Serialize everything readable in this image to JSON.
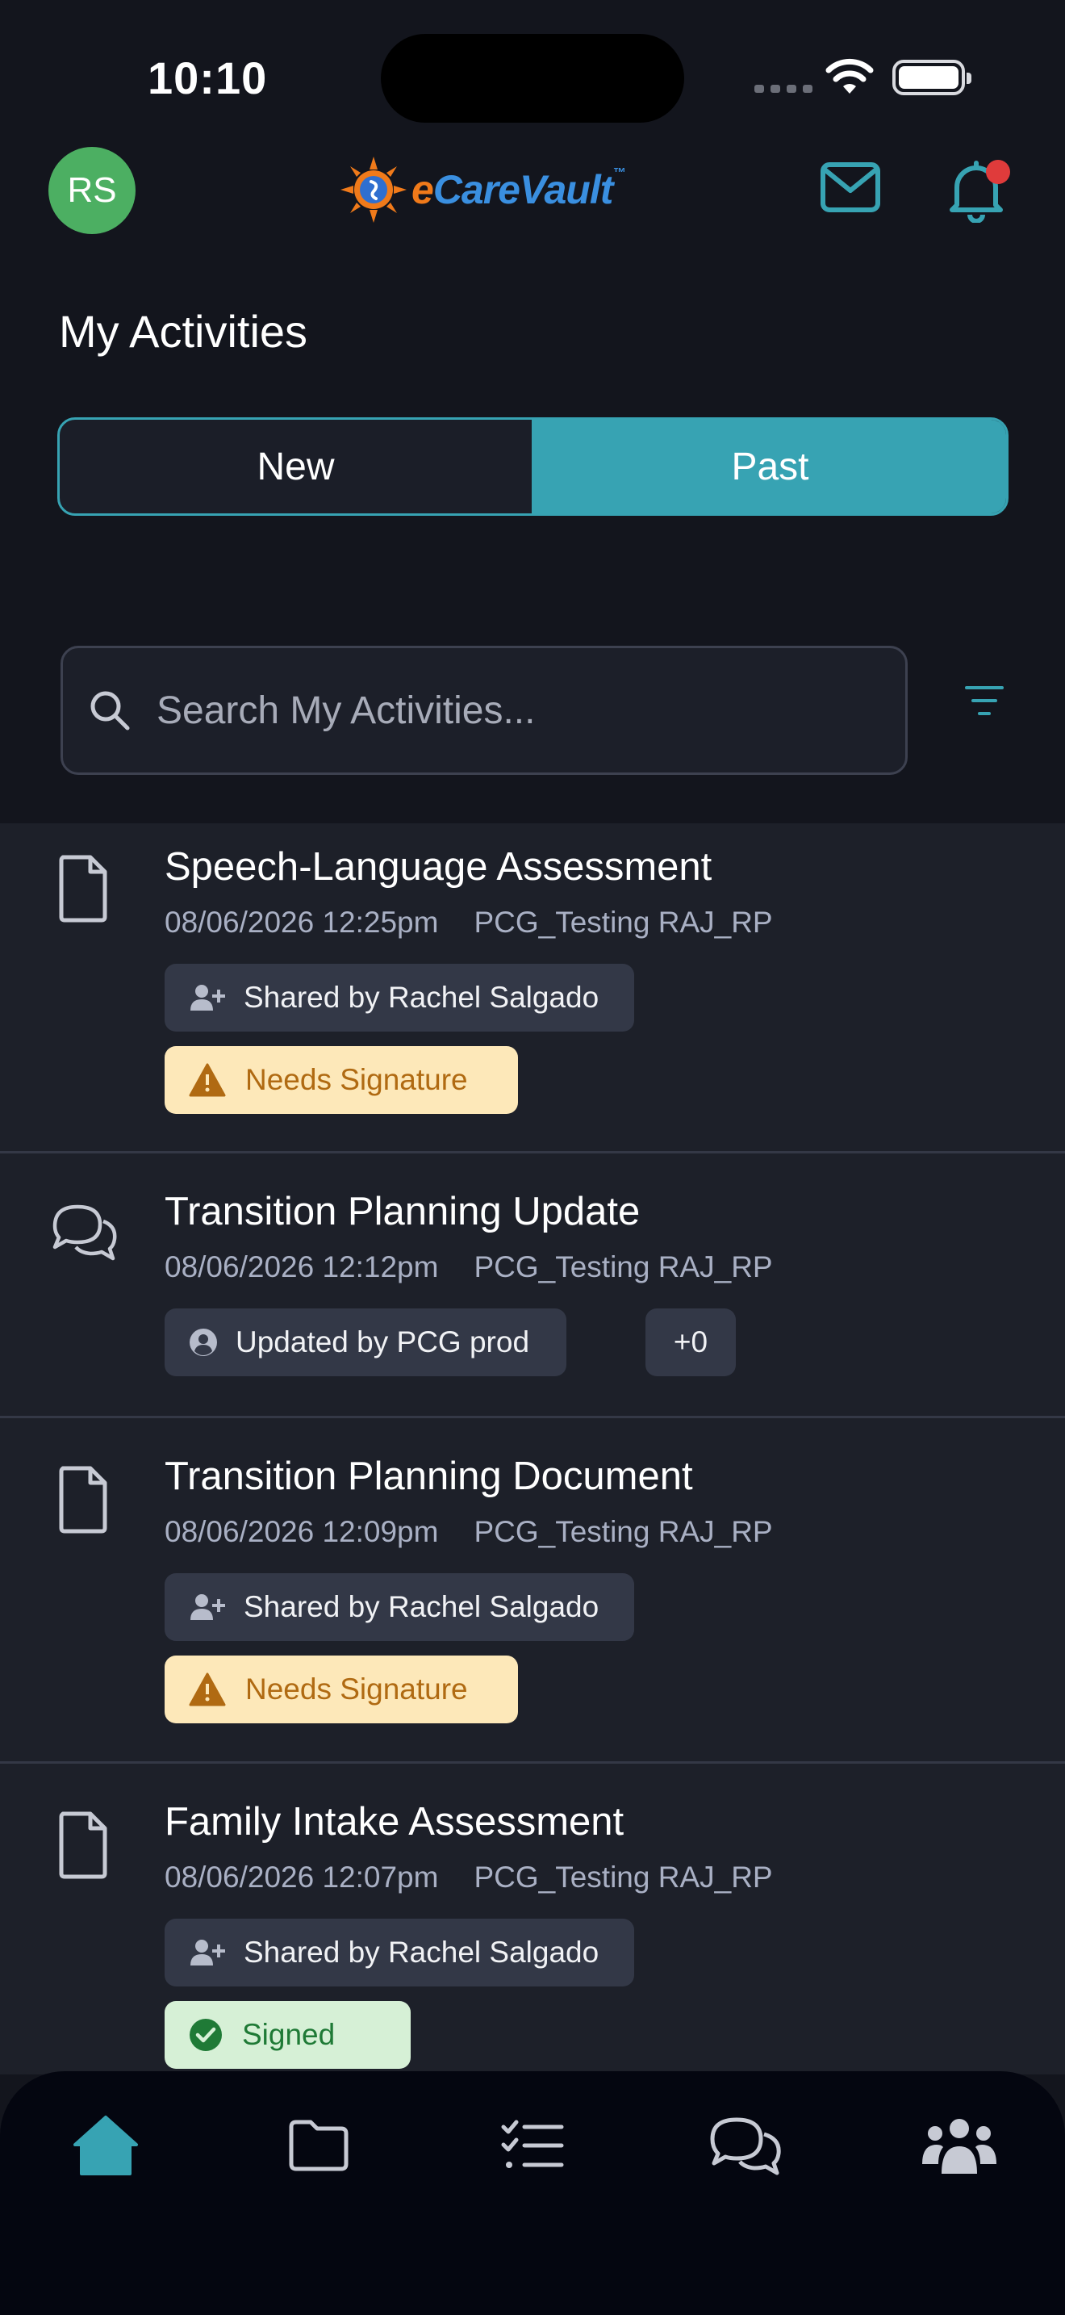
{
  "status_bar": {
    "time": "10:10"
  },
  "header": {
    "avatar_initials": "RS",
    "logo_text_e": "e",
    "logo_text_rest": "CareVault",
    "logo_tm": "™"
  },
  "page": {
    "title": "My Activities"
  },
  "tabs": [
    {
      "label": "New",
      "active": false
    },
    {
      "label": "Past",
      "active": true
    }
  ],
  "search": {
    "placeholder": "Search My Activities..."
  },
  "activities": [
    {
      "icon": "document-icon",
      "title": "Speech-Language Assessment",
      "datetime": "08/06/2026 12:25pm",
      "org": "PCG_Testing RAJ_RP",
      "chip": "Shared by Rachel Salgado",
      "status": "Needs Signature"
    },
    {
      "icon": "chat-icon",
      "title": "Transition Planning Update",
      "datetime": "08/06/2026 12:12pm",
      "org": "PCG_Testing RAJ_RP",
      "chip": "Updated by PCG prod",
      "count": "+0"
    },
    {
      "icon": "document-icon",
      "title": "Transition Planning Document",
      "datetime": "08/06/2026 12:09pm",
      "org": "PCG_Testing RAJ_RP",
      "chip": "Shared by Rachel Salgado",
      "status": "Needs Signature"
    },
    {
      "icon": "document-icon",
      "title": "Family Intake Assessment",
      "datetime": "08/06/2026 12:07pm",
      "org": "PCG_Testing RAJ_RP",
      "chip": "Shared by Rachel Salgado",
      "status": "Signed"
    }
  ],
  "bottom_nav": [
    {
      "icon": "home-icon",
      "active": true
    },
    {
      "icon": "folder-icon",
      "active": false
    },
    {
      "icon": "checklist-icon",
      "active": false
    },
    {
      "icon": "chat-icon",
      "active": false
    },
    {
      "icon": "people-icon",
      "active": false
    }
  ],
  "colors": {
    "accent": "#37a3b3",
    "background": "#13151d",
    "card": "#1d2029",
    "warning_bg": "#fde8b9",
    "success_bg": "#d6f0d6",
    "notification_dot": "#e03b3b"
  }
}
